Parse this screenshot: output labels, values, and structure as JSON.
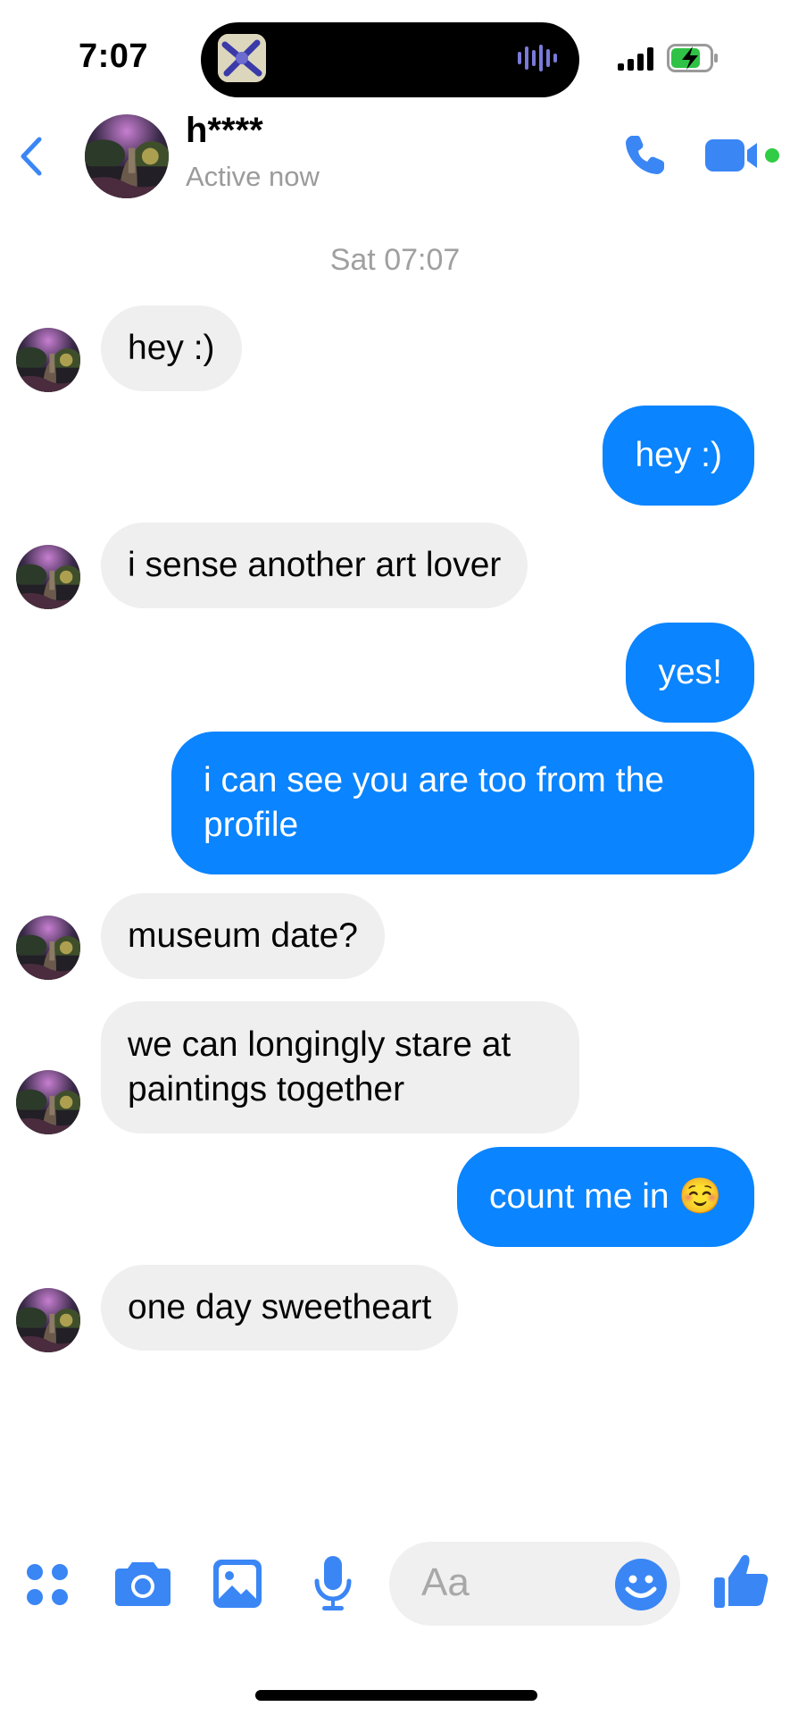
{
  "status_bar": {
    "time": "7:07",
    "island_app_icon": "audio-app-icon",
    "island_indicator": "waveform-icon",
    "signal_icon": "cellular-signal-icon",
    "battery_icon": "battery-charging-icon"
  },
  "header": {
    "back_icon": "chevron-left-icon",
    "contact_name": "h****",
    "contact_status": "Active now",
    "call_icon": "phone-icon",
    "video_icon": "video-camera-icon",
    "active_color": "#31cc46"
  },
  "conversation": {
    "timestamp": "Sat 07:07",
    "messages": [
      {
        "from": "them",
        "text": "hey :)"
      },
      {
        "from": "me",
        "text": "hey :)"
      },
      {
        "from": "them",
        "text": "i sense another art lover"
      },
      {
        "from": "me",
        "text": "yes!"
      },
      {
        "from": "me",
        "text": "i can see you are too from the profile"
      },
      {
        "from": "them",
        "text": "museum date?"
      },
      {
        "from": "them",
        "text": "we can longingly stare at paintings together"
      },
      {
        "from": "me",
        "text": "count me in ☺️"
      },
      {
        "from": "them",
        "text": "one day sweetheart"
      }
    ]
  },
  "composer": {
    "placeholder": "Aa",
    "icons": [
      "apps-icon",
      "camera-icon",
      "gallery-icon",
      "microphone-icon",
      "emoji-icon",
      "thumbs-up-icon"
    ]
  },
  "colors": {
    "accent": "#0a84ff",
    "icon_blue": "#3a86f5",
    "incoming_bubble": "#efefef",
    "muted_text": "#9b9b9b"
  }
}
